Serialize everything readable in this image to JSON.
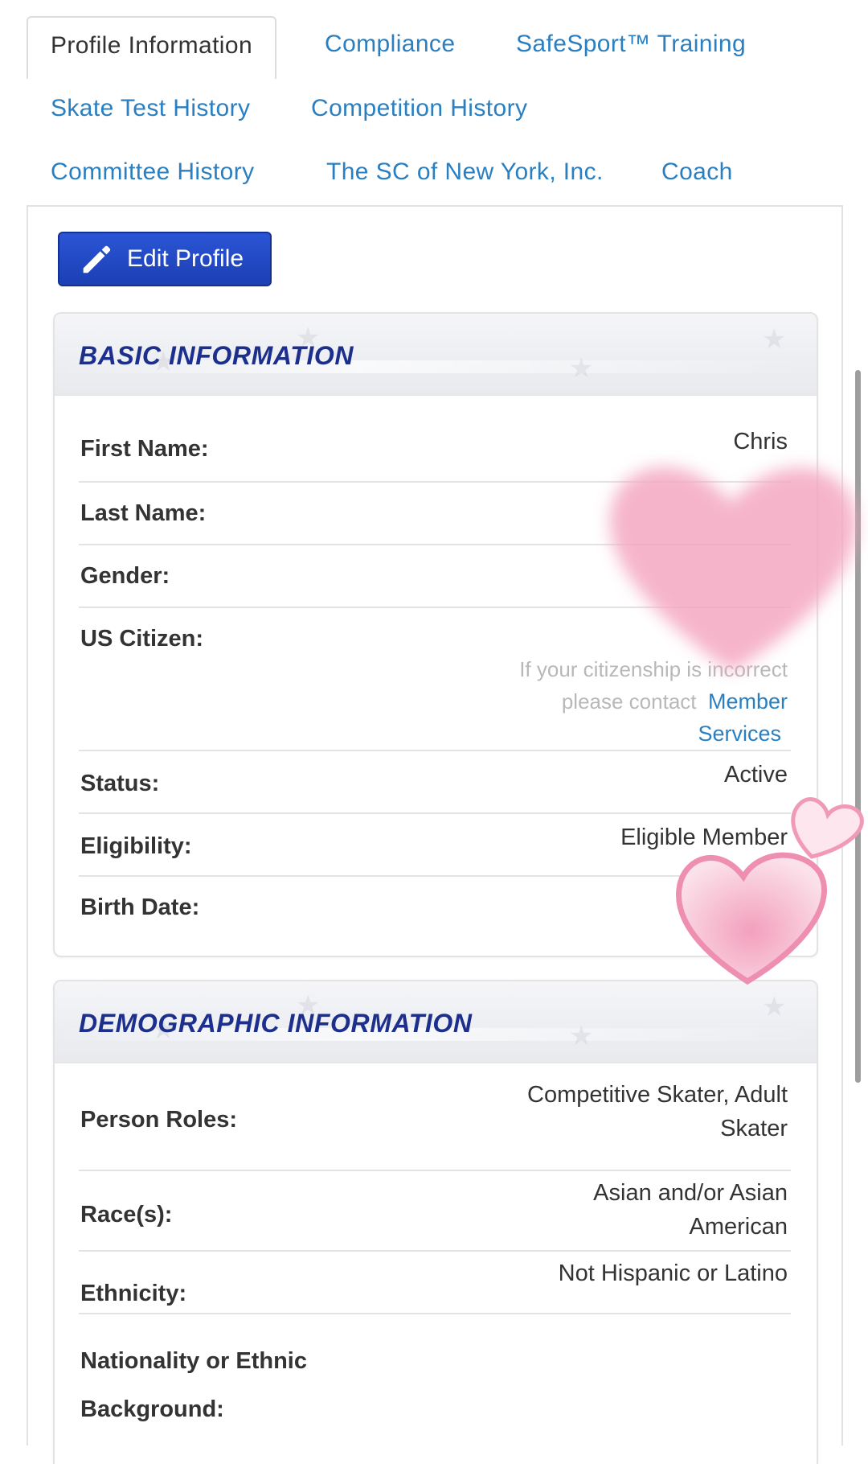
{
  "tabs": {
    "profile": "Profile Information",
    "compliance": "Compliance",
    "safesport": "SafeSport™ Training",
    "skate_test": "Skate Test History",
    "competition": "Competition History",
    "committee": "Committee History",
    "club": "The SC of New York, Inc.",
    "coach": "Coach"
  },
  "edit_button": "Edit Profile",
  "basic": {
    "title": "BASIC INFORMATION",
    "first_name_label": "First Name:",
    "first_name_value": "Chris",
    "last_name_label": "Last Name:",
    "gender_label": "Gender:",
    "citizen_label": "US Citizen:",
    "citizen_note_line1": "If your citizenship is incorrect",
    "citizen_note_line2": "please contact",
    "member_services_line1": "Member",
    "member_services_line2": "Services",
    "status_label": "Status:",
    "status_value": "Active",
    "eligibility_label": "Eligibility:",
    "eligibility_value": "Eligible Member",
    "birth_label": "Birth Date:"
  },
  "demographic": {
    "title": "DEMOGRAPHIC INFORMATION",
    "roles_label": "Person Roles:",
    "roles_value_line1": "Competitive Skater, Adult",
    "roles_value_line2": "Skater",
    "race_label": "Race(s):",
    "race_value_line1": "Asian and/or Asian",
    "race_value_line2": "American",
    "ethnicity_label": "Ethnicity:",
    "ethnicity_value": "Not Hispanic or Latino",
    "nationality_label_line1": "Nationality or Ethnic",
    "nationality_label_line2": "Background:"
  },
  "colors": {
    "link": "#2a7fc1",
    "primary_button": "#1f46c4",
    "section_title": "#1c2f8c",
    "sticker_pink": "#f2a1bd"
  },
  "icons": {
    "edit": "pencil-icon",
    "stickers": "heart-sticker"
  }
}
